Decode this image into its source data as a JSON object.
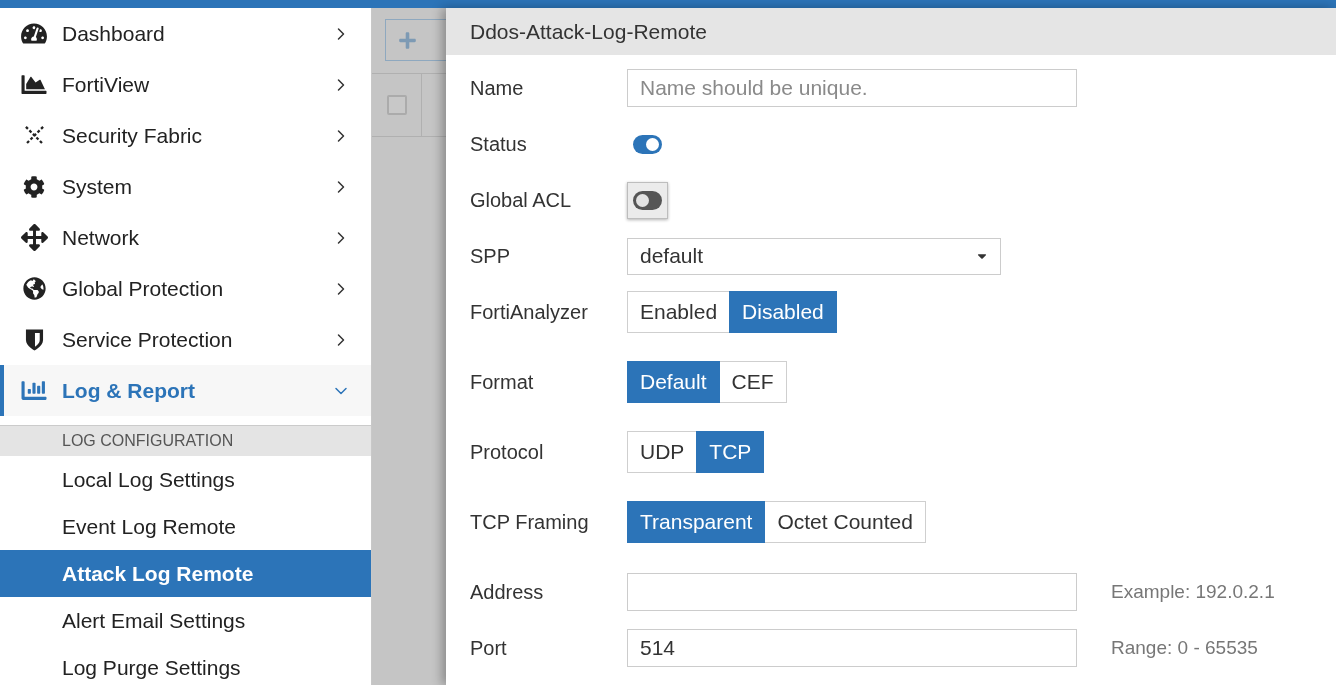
{
  "sidebar": {
    "items": [
      {
        "label": "Dashboard",
        "selected": false,
        "expanded": false
      },
      {
        "label": "FortiView",
        "selected": false,
        "expanded": false
      },
      {
        "label": "Security Fabric",
        "selected": false,
        "expanded": false
      },
      {
        "label": "System",
        "selected": false,
        "expanded": false
      },
      {
        "label": "Network",
        "selected": false,
        "expanded": false
      },
      {
        "label": "Global Protection",
        "selected": false,
        "expanded": false
      },
      {
        "label": "Service Protection",
        "selected": false,
        "expanded": false
      },
      {
        "label": "Log & Report",
        "selected": true,
        "expanded": true
      }
    ],
    "section": {
      "title": "LOG CONFIGURATION",
      "items": [
        {
          "label": "Local Log Settings",
          "selected": false
        },
        {
          "label": "Event Log Remote",
          "selected": false
        },
        {
          "label": "Attack Log Remote",
          "selected": true
        },
        {
          "label": "Alert Email Settings",
          "selected": false
        },
        {
          "label": "Log Purge Settings",
          "selected": false
        }
      ]
    }
  },
  "list_view": {
    "select_all": {
      "checked": false
    }
  },
  "panel": {
    "title": "Ddos-Attack-Log-Remote",
    "fields": [
      {
        "kind": "text",
        "label": "Name",
        "placeholder": "Name should be unique."
      },
      {
        "kind": "toggle",
        "label": "Status",
        "on": true,
        "focused": false
      },
      {
        "kind": "toggle",
        "label": "Global ACL",
        "on": false,
        "focused": true
      },
      {
        "kind": "select",
        "label": "SPP",
        "value": "default"
      },
      {
        "kind": "segmented",
        "label": "FortiAnalyzer",
        "options": [
          {
            "label": "Enabled",
            "selected": false
          },
          {
            "label": "Disabled",
            "selected": true
          }
        ]
      },
      {
        "kind": "segmented",
        "label": "Format",
        "options": [
          {
            "label": "Default",
            "selected": true
          },
          {
            "label": "CEF",
            "selected": false
          }
        ]
      },
      {
        "kind": "segmented",
        "label": "Protocol",
        "options": [
          {
            "label": "UDP",
            "selected": false
          },
          {
            "label": "TCP",
            "selected": true
          }
        ]
      },
      {
        "kind": "segmented",
        "label": "TCP Framing",
        "options": [
          {
            "label": "Transparent",
            "selected": true
          },
          {
            "label": "Octet Counted",
            "selected": false
          }
        ]
      },
      {
        "kind": "text",
        "label": "Address",
        "hint": "Example: 192.0.2.1"
      },
      {
        "kind": "text",
        "label": "Port",
        "value": "514",
        "hint": "Range: 0 - 65535"
      }
    ]
  }
}
